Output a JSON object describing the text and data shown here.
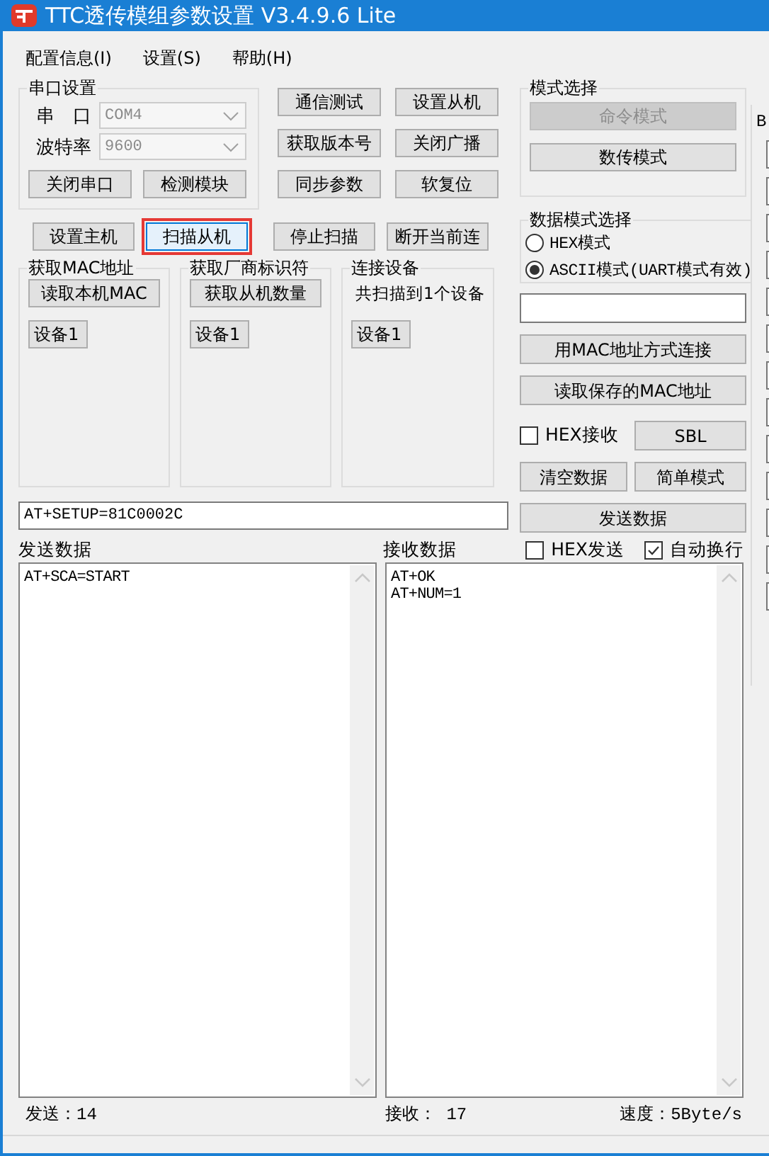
{
  "window": {
    "title": "TTC透传模组参数设置 V3.4.9.6 Lite"
  },
  "menu": [
    "配置信息(I)",
    "设置(S)",
    "帮助(H)"
  ],
  "serial_group": {
    "title": "串口设置",
    "port_label": "串　口",
    "port": "COM4",
    "baud_label": "波特率",
    "baud": "9600",
    "buttons": [
      "关闭串口",
      "检测模块"
    ]
  },
  "command_columns": [
    [
      "通信测试",
      "获取版本号",
      "同步参数"
    ],
    [
      "设置从机",
      "关闭广播",
      "软复位"
    ]
  ],
  "scan_buttons": [
    {
      "label": "设置主机",
      "highlighted": false
    },
    {
      "label": "扫描从机",
      "highlighted": true
    },
    {
      "label": "停止扫描",
      "highlighted": false
    },
    {
      "label": "断开当前连",
      "highlighted": false
    }
  ],
  "groups": [
    {
      "title": "获取MAC地址",
      "button": "读取本机MAC",
      "devices": [
        "设备1"
      ]
    },
    {
      "title": "获取厂商标识符",
      "button": "获取从机数量",
      "devices": [
        "设备1"
      ]
    },
    {
      "title": "连接设备",
      "info": "共扫描到1个设备",
      "devices": [
        "设备1"
      ]
    }
  ],
  "command_input": {
    "value": "AT+SETUP=81C0002C"
  },
  "mode_group": {
    "title": "模式选择",
    "buttons": [
      {
        "label": "命令模式",
        "disabled": true
      },
      {
        "label": "数传模式",
        "disabled": false
      }
    ]
  },
  "data_mode_group": {
    "title": "数据模式选择",
    "options": [
      {
        "label": "HEX模式",
        "selected": false
      },
      {
        "label": "ASCII模式(UART模式有效)",
        "selected": true
      }
    ]
  },
  "mac_buttons": [
    "用MAC地址方式连接",
    "读取保存的MAC地址"
  ],
  "hex_receive": {
    "label": "HEX接收",
    "checked": false
  },
  "sbl_button": "SBL",
  "pair_buttons": [
    "清空数据",
    "简单模式"
  ],
  "send_button": "发送数据",
  "send_panel": {
    "title": "发送数据",
    "lines": [
      "AT+SCA=START"
    ]
  },
  "receive_panel": {
    "title": "接收数据",
    "lines": [
      "AT+OK",
      "AT+NUM=1"
    ]
  },
  "receive_options": [
    {
      "label": "HEX发送",
      "checked": false
    },
    {
      "label": "自动换行",
      "checked": true
    }
  ],
  "status": {
    "sent": "发送：14",
    "received": "接收： 17",
    "speed": "速度：5Byte/s"
  },
  "side_panel": {
    "label": "B"
  }
}
